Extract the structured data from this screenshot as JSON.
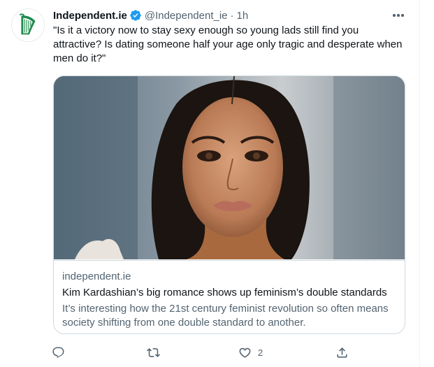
{
  "tweet": {
    "author_name": "Independent.ie",
    "handle": "@Independent_ie",
    "separator": "·",
    "time": "1h",
    "text": "\"Is it a victory now to stay sexy enough so young lads still find you attractive? Is dating someone half your age only tragic and desperate when men do it?\"",
    "avatar_icon": "harp-logo-icon",
    "verified_icon": "verified-badge-icon",
    "more_icon": "more-options-icon"
  },
  "card": {
    "domain": "independent.ie",
    "title": "Kim Kardashian’s big romance shows up feminism’s double standards",
    "description": "It’s interesting how the 21st century feminist revolution so often means society shifting from one double standard to another.",
    "image_icon": "article-photo"
  },
  "actions": {
    "reply": {
      "icon": "reply-icon",
      "count": ""
    },
    "retweet": {
      "icon": "retweet-icon",
      "count": ""
    },
    "like": {
      "icon": "heart-icon",
      "count": "2"
    },
    "share": {
      "icon": "share-icon",
      "count": ""
    }
  },
  "colors": {
    "brand_green": "#1f8a4c",
    "verified_blue": "#1d9bf0",
    "text_primary": "#0f1419",
    "text_secondary": "#536471",
    "border": "#cfd9de"
  }
}
